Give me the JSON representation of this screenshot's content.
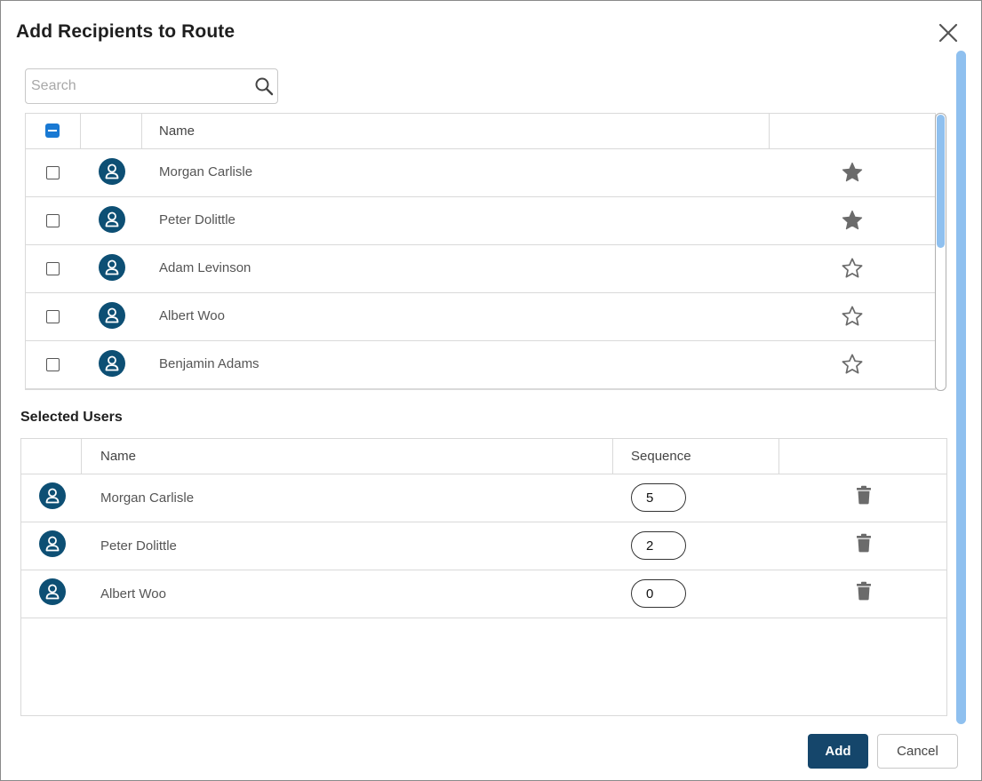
{
  "dialog": {
    "title": "Add Recipients to Route",
    "close_icon": "close-icon"
  },
  "search": {
    "placeholder": "Search",
    "value": "",
    "icon": "search-icon"
  },
  "users_table": {
    "header": {
      "name": "Name"
    },
    "master_checkbox_state": "indeterminate",
    "rows": [
      {
        "name": "Morgan Carlisle",
        "favorite": true,
        "checked": false
      },
      {
        "name": "Peter Dolittle",
        "favorite": true,
        "checked": false
      },
      {
        "name": "Adam Levinson",
        "favorite": false,
        "checked": false
      },
      {
        "name": "Albert Woo",
        "favorite": false,
        "checked": false
      },
      {
        "name": "Benjamin Adams",
        "favorite": false,
        "checked": false
      }
    ]
  },
  "selected": {
    "title": "Selected Users",
    "header": {
      "name": "Name",
      "sequence": "Sequence"
    },
    "rows": [
      {
        "name": "Morgan Carlisle",
        "sequence": "5"
      },
      {
        "name": "Peter Dolittle",
        "sequence": "2"
      },
      {
        "name": "Albert Woo",
        "sequence": "0"
      }
    ]
  },
  "footer": {
    "add_label": "Add",
    "cancel_label": "Cancel"
  },
  "colors": {
    "avatar": "#0d4f74",
    "primary_button": "#15466b",
    "checkbox_accent": "#1979d3",
    "scrollbar": "#8fc0ef",
    "star": "#6b6b6b"
  }
}
